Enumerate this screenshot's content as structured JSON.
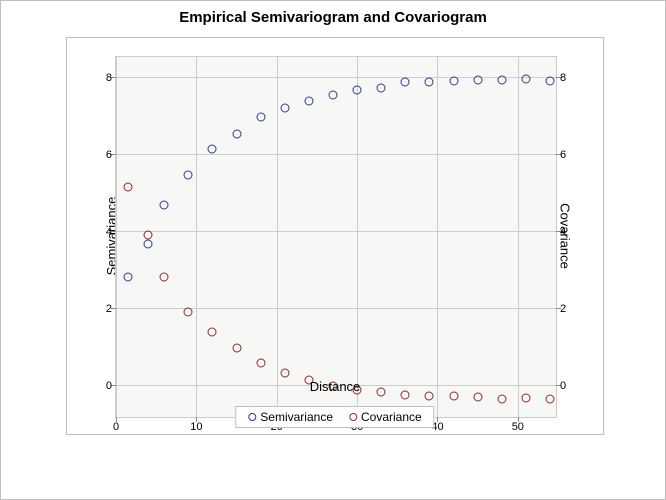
{
  "chart_data": {
    "type": "scatter",
    "title": "Empirical Semivariogram and Covariogram",
    "xlabel": "Distance",
    "ylabel_left": "Semivariance",
    "ylabel_right": "Covariance",
    "x_ticks": [
      0,
      10,
      20,
      30,
      40,
      50
    ],
    "y_ticks_left": [
      0,
      2,
      4,
      6,
      8
    ],
    "y_ticks_right": [
      0,
      2,
      4,
      6,
      8
    ],
    "xlim": [
      0,
      55
    ],
    "ylim": [
      -0.8,
      8.6
    ],
    "x": [
      1.5,
      4,
      6,
      9,
      12,
      15,
      18,
      21,
      24,
      27,
      30,
      33,
      36,
      39,
      42,
      45,
      48,
      51,
      54
    ],
    "series": [
      {
        "name": "Semivariance",
        "color": "#2a3f8f",
        "values": [
          2.83,
          3.7,
          4.7,
          5.48,
          6.15,
          6.55,
          6.98,
          7.23,
          7.4,
          7.57,
          7.7,
          7.75,
          7.9,
          7.91,
          7.92,
          7.94,
          7.96,
          7.98,
          7.93
        ]
      },
      {
        "name": "Covariance",
        "color": "#8f2a2a",
        "values": [
          5.18,
          3.92,
          2.83,
          1.92,
          1.4,
          0.98,
          0.6,
          0.35,
          0.15,
          0.0,
          -0.1,
          -0.15,
          -0.23,
          -0.25,
          -0.26,
          -0.27,
          -0.32,
          -0.31,
          -0.33
        ]
      }
    ],
    "legend": [
      "Semivariance",
      "Covariance"
    ]
  }
}
